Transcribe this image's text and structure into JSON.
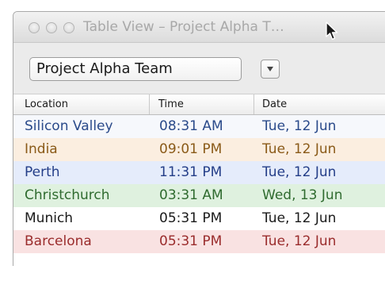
{
  "window": {
    "title": "Table View – Project Alpha T…",
    "buttons": [
      "close",
      "minimize",
      "zoom"
    ]
  },
  "toolbar": {
    "team_select_value": "Project Alpha Team",
    "dropdown_icon": "triangle-down-icon"
  },
  "table": {
    "columns": [
      "Location",
      "Time",
      "Date"
    ],
    "rows": [
      {
        "location": "Silicon Valley",
        "time": "08:31 AM",
        "date": "Tue, 12 Jun",
        "text_color": "#2a4a8a",
        "background": "#f6f8fc"
      },
      {
        "location": "India",
        "time": "09:01 PM",
        "date": "Tue, 12 Jun",
        "text_color": "#8a5a18",
        "background": "#fbeee0"
      },
      {
        "location": "Perth",
        "time": "11:31 PM",
        "date": "Tue, 12 Jun",
        "text_color": "#243e88",
        "background": "#e5ecfb"
      },
      {
        "location": "Christchurch",
        "time": "03:31 AM",
        "date": "Wed, 13 Jun",
        "text_color": "#2f6b2f",
        "background": "#dff1df"
      },
      {
        "location": "Munich",
        "time": "05:31 PM",
        "date": "Tue, 12 Jun",
        "text_color": "#1a1a1a",
        "background": "#ffffff"
      },
      {
        "location": "Barcelona",
        "time": "05:31 PM",
        "date": "Tue, 12 Jun",
        "text_color": "#9a2c2c",
        "background": "#f9e2e2"
      }
    ]
  }
}
